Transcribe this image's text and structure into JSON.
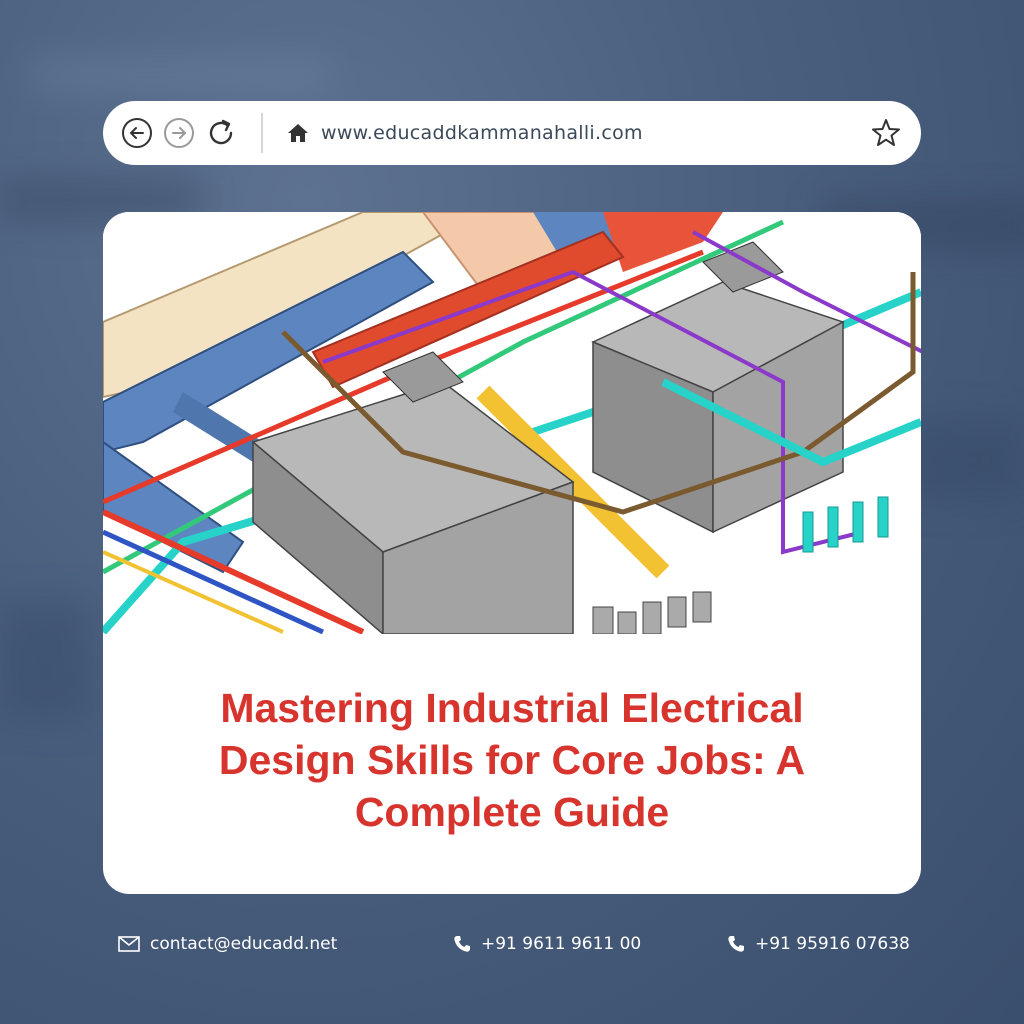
{
  "browser": {
    "url": "www.educaddkammanahalli.com",
    "back_icon": "arrow-left-circle-icon",
    "forward_icon": "arrow-right-circle-icon",
    "reload_icon": "reload-icon",
    "home_icon": "home-icon",
    "bookmark_icon": "star-icon"
  },
  "card": {
    "image_subject": "3D MEP model of industrial piping, ducts, and water tanks",
    "title_line1": "Mastering Industrial Electrical",
    "title_line2": "Design Skills for Core Jobs: A",
    "title_line3": "Complete Guide"
  },
  "footer": {
    "email": "contact@educadd.net",
    "phone1": "+91 9611 9611 00",
    "phone2": "+91 95916 07638"
  },
  "colors": {
    "title": "#d8342e",
    "background": "#4a5f7e"
  }
}
